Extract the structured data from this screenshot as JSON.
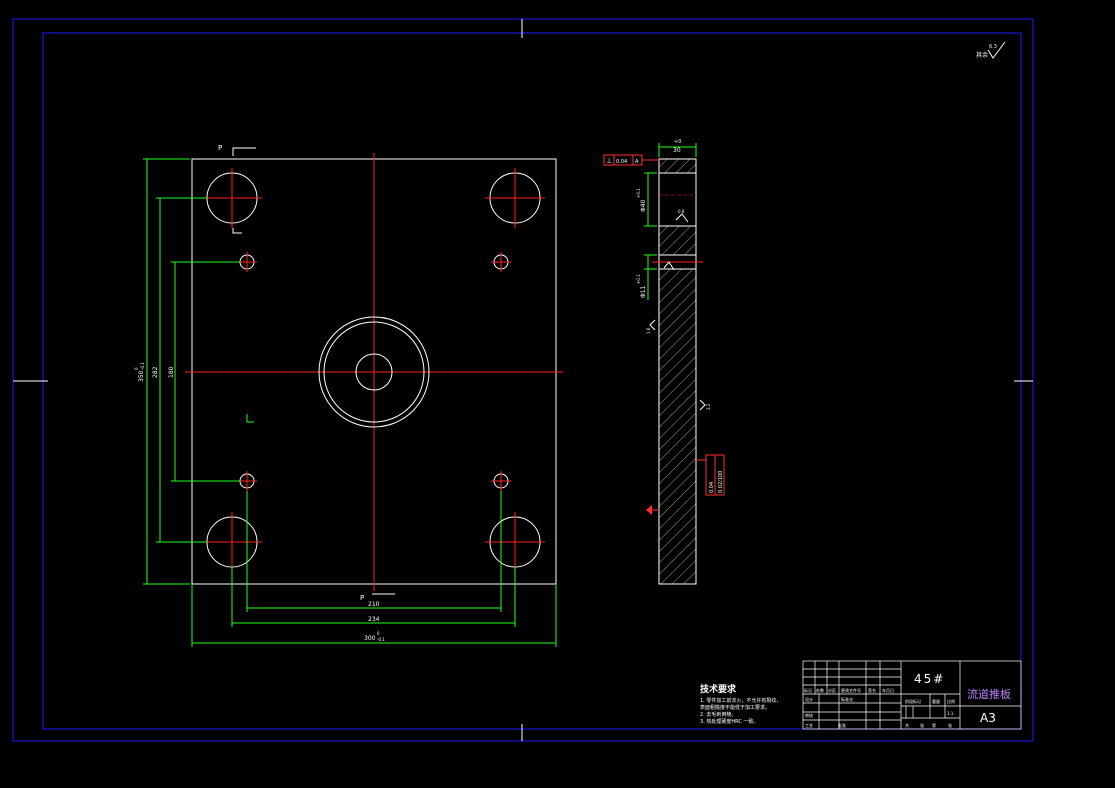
{
  "drawing": {
    "material": "45#",
    "part_name": "流道推板",
    "sheet_size": "A3",
    "surface_finish": {
      "prefix": "其余",
      "value": "6.3"
    }
  },
  "technical_requirements": {
    "title": "技术要求",
    "items": [
      "1. 零件加工前淬火，不允许有裂纹、",
      "表面粗糙度不能低于加工要求。",
      "2. 去毛刺倒棱。",
      "3. 热处理硬度HRC 一致。"
    ]
  },
  "front_view": {
    "section_mark": "P",
    "dims": {
      "inner_spacing": "210",
      "outer_spacing": "234",
      "overall_width": "300",
      "width_tol_upper": "0",
      "width_tol_lower": "-0.1",
      "overall_height": "350",
      "height_tol_upper": "0",
      "height_tol_lower": "-0.1",
      "large_hole_spacing_v": "282",
      "small_hole_spacing_v": "180"
    }
  },
  "side_view": {
    "thickness": "30",
    "thickness_tol": "+0",
    "flatness_ref": "0.04",
    "datum": "A",
    "bore_dia": "Φ40",
    "bore_tol": "+0.1",
    "small_bore_dia": "Φ11",
    "small_bore_tol": "+0.1",
    "roughness_a": "0.8",
    "roughness_b": "1.6",
    "roughness_c": "3.2",
    "parallel_tol": "0.04",
    "perp_tol": "0.02/100"
  },
  "title_block": {
    "row_labels": [
      "标记",
      "处数",
      "分区",
      "更改文件号",
      "签名",
      "年月日"
    ],
    "designer": "设计",
    "std": "标准化",
    "review": "审核",
    "process": "工艺",
    "approve": "批准",
    "stage": "阶段标记",
    "weight": "重量",
    "scale": "比例",
    "scale_value": "1:1",
    "sheet": "共",
    "sheet2": "张",
    "sheet3": "第",
    "sheet4": "张"
  },
  "colors": {
    "border": "#1a1aff",
    "outline": "#ffffff",
    "center": "#ff2020",
    "dimension": "#20ff20",
    "annotation": "#00ffff",
    "tolerance": "#ff3030"
  }
}
